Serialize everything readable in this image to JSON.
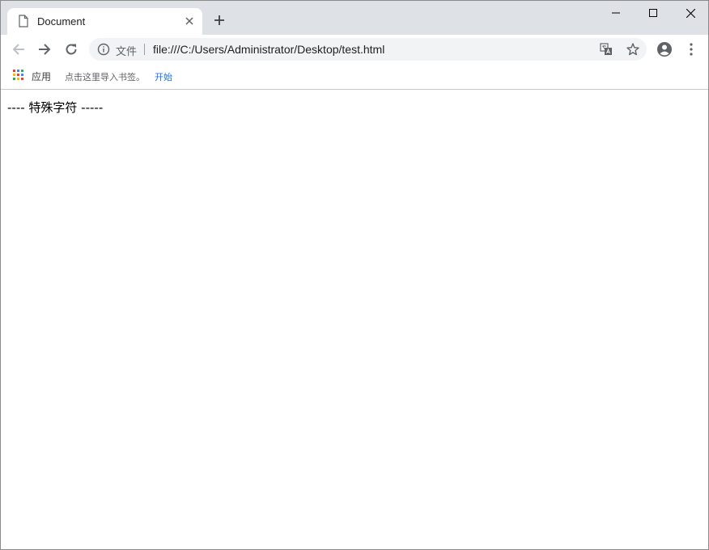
{
  "window": {
    "controls": {
      "minimize": "minimize",
      "maximize": "maximize",
      "close": "close"
    }
  },
  "tab": {
    "title": "Document",
    "icon": "document-icon",
    "new_tab_icon": "plus-icon"
  },
  "toolbar": {
    "back_icon": "arrow-left-icon",
    "forward_icon": "arrow-right-icon",
    "reload_icon": "reload-icon",
    "scheme_label": "文件",
    "url": "file:///C:/Users/Administrator/Desktop/test.html",
    "translate_icon": "translate-icon",
    "bookmark_icon": "star-icon",
    "profile_icon": "account-circle-icon",
    "menu_icon": "kebab-menu-icon"
  },
  "bookmarks_bar": {
    "apps_label": "应用",
    "import_prompt": "点击这里导入书签。",
    "import_link": "开始"
  },
  "page": {
    "content": "---- 特殊字符 -----"
  },
  "colors": {
    "titlebar": "#dee1e6",
    "omnibox": "#f1f3f4",
    "link": "#1a73e8"
  }
}
